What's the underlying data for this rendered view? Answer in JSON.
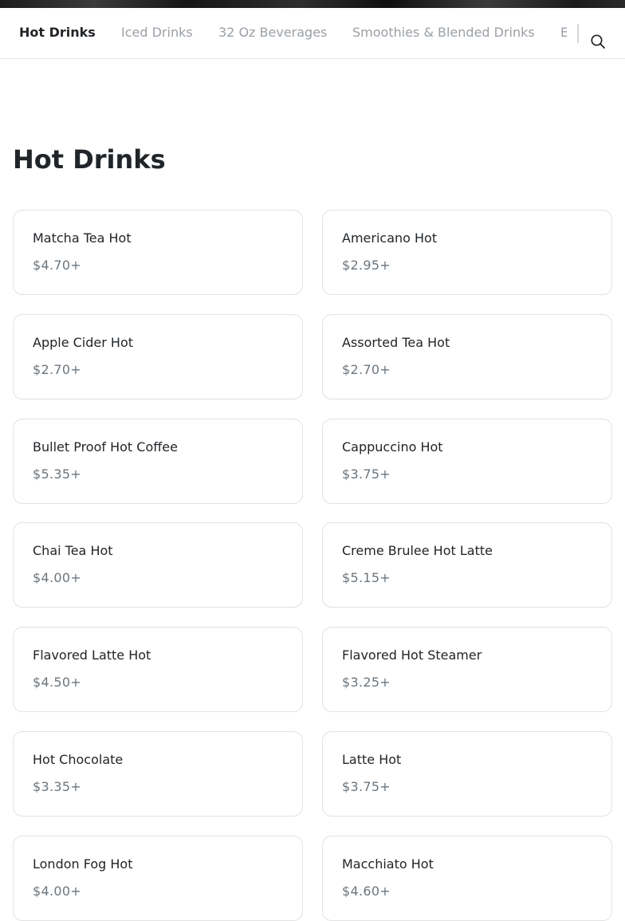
{
  "nav": {
    "tabs": [
      {
        "label": "Hot Drinks",
        "active": true
      },
      {
        "label": "Iced Drinks",
        "active": false
      },
      {
        "label": "32 Oz Beverages",
        "active": false
      },
      {
        "label": "Smoothies & Blended Drinks",
        "active": false
      },
      {
        "label": "E",
        "active": false
      }
    ],
    "search_icon": "search-icon"
  },
  "section": {
    "title": "Hot Drinks"
  },
  "items": [
    {
      "name": "Matcha Tea Hot",
      "price": "$4.70+"
    },
    {
      "name": "Americano Hot",
      "price": "$2.95+"
    },
    {
      "name": "Apple Cider Hot",
      "price": "$2.70+"
    },
    {
      "name": "Assorted Tea Hot",
      "price": "$2.70+"
    },
    {
      "name": "Bullet Proof Hot Coffee",
      "price": "$5.35+"
    },
    {
      "name": "Cappuccino Hot",
      "price": "$3.75+"
    },
    {
      "name": "Chai Tea Hot",
      "price": "$4.00+"
    },
    {
      "name": "Creme Brulee Hot Latte",
      "price": "$5.15+"
    },
    {
      "name": "Flavored Latte Hot",
      "price": "$4.50+"
    },
    {
      "name": "Flavored Hot Steamer",
      "price": "$3.25+"
    },
    {
      "name": "Hot Chocolate",
      "price": "$3.35+"
    },
    {
      "name": "Latte Hot",
      "price": "$3.75+"
    },
    {
      "name": "London Fog Hot",
      "price": "$4.00+"
    },
    {
      "name": "Macchiato Hot",
      "price": "$4.60+"
    }
  ]
}
